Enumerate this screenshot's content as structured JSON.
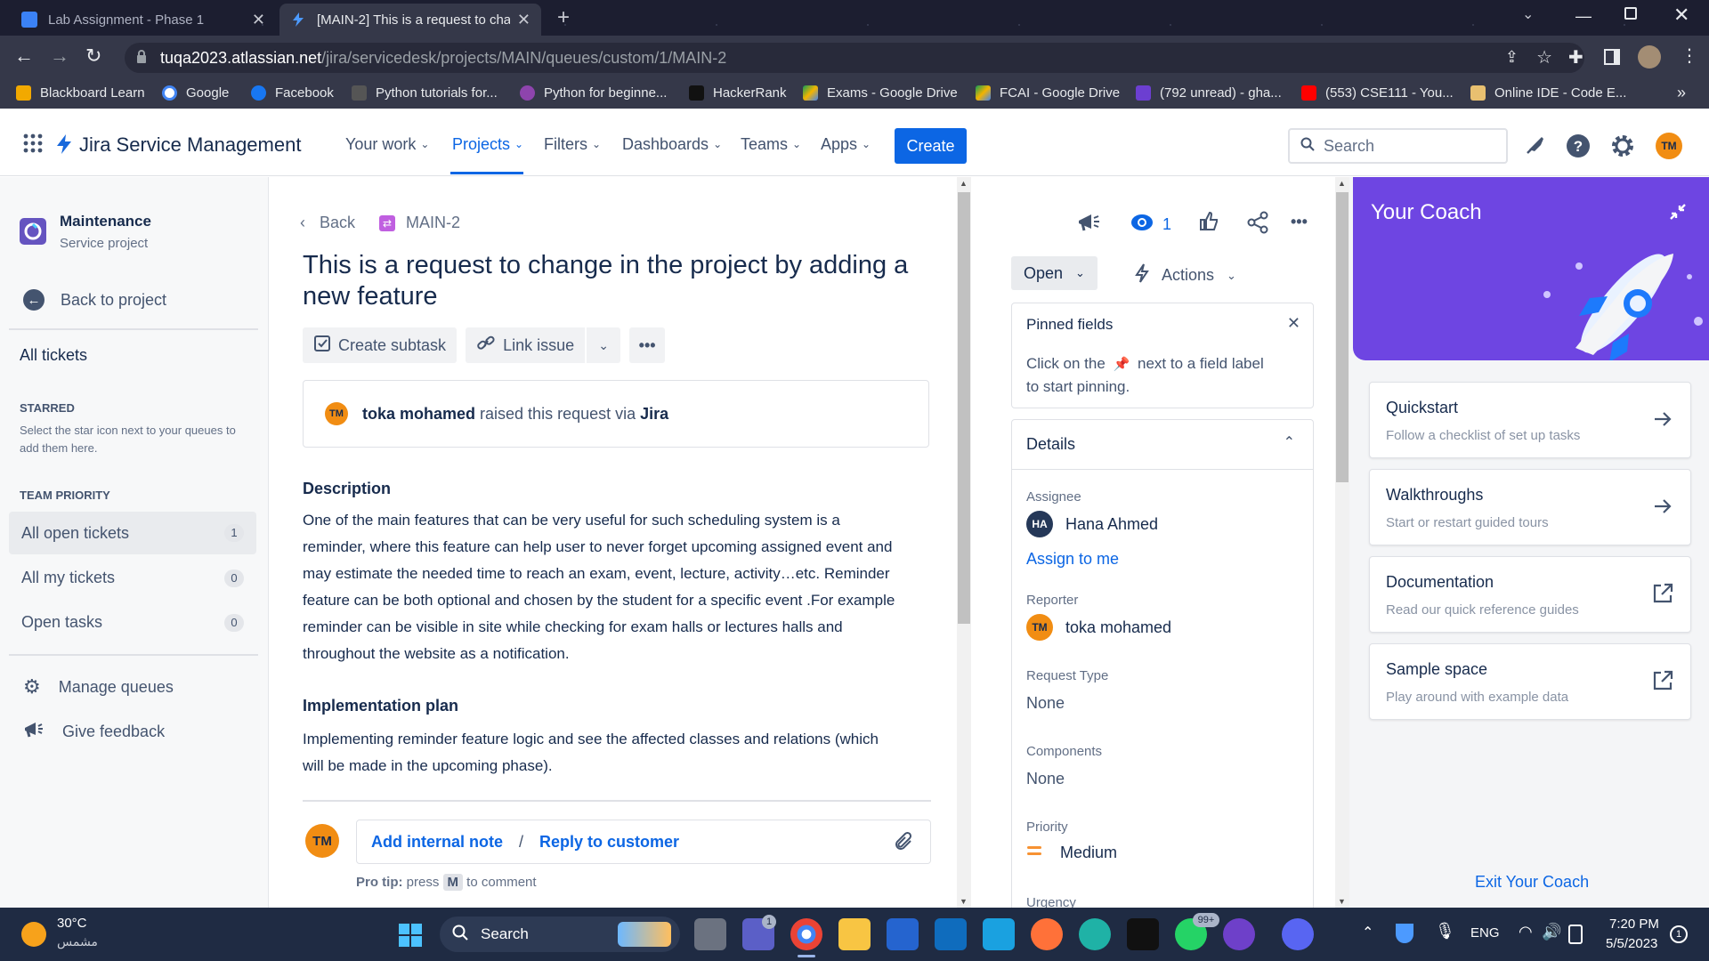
{
  "browser": {
    "tabs": [
      {
        "title": "Lab Assignment - Phase 1",
        "active": false
      },
      {
        "title": "[MAIN-2] This is a request to cha",
        "active": true
      }
    ],
    "url_host": "tuqa2023.atlassian.net",
    "url_path": "/jira/servicedesk/projects/MAIN/queues/custom/1/MAIN-2",
    "bookmarks": [
      "Blackboard Learn",
      "Google",
      "Facebook",
      "Python tutorials for...",
      "Python for beginne...",
      "HackerRank",
      "Exams - Google Drive",
      "FCAI - Google Drive",
      "(792 unread) - gha...",
      "(553) CSE111 - You...",
      "Online IDE - Code E..."
    ]
  },
  "nav": {
    "product": "Jira Service Management",
    "items": [
      "Your work",
      "Projects",
      "Filters",
      "Dashboards",
      "Teams",
      "Apps"
    ],
    "active": "Projects",
    "create": "Create",
    "search_placeholder": "Search",
    "user_initials": "TM"
  },
  "sidebar": {
    "project_name": "Maintenance",
    "project_type": "Service project",
    "back": "Back to project",
    "all_tickets": "All tickets",
    "starred_heading": "STARRED",
    "starred_hint": "Select the star icon next to your queues to add them here.",
    "team_priority_heading": "TEAM PRIORITY",
    "queues": [
      {
        "label": "All open tickets",
        "count": "1"
      },
      {
        "label": "All my tickets",
        "count": "0"
      },
      {
        "label": "Open tasks",
        "count": "0"
      }
    ],
    "manage_queues": "Manage queues",
    "give_feedback": "Give feedback"
  },
  "issue": {
    "back": "Back",
    "key": "MAIN-2",
    "title_line1": "This is a request to change in the project by adding a",
    "title_line2": "new feature",
    "actions": {
      "create_subtask": "Create subtask",
      "link_issue": "Link issue"
    },
    "raised": {
      "user": "toka mohamed",
      "text": " raised this request via ",
      "channel": "Jira",
      "initials": "TM"
    },
    "description_heading": "Description",
    "description_lines": [
      "One of the main features that can be very useful for such scheduling system is a",
      "reminder, where this feature can help user to never forget upcoming assigned event and",
      "may estimate the needed time to reach an exam, event, lecture, activity…etc. Reminder",
      "feature can be both optional and chosen by the student for a specific event .For example",
      "reminder can be visible in site while checking for exam halls or lectures halls and",
      "throughout the website as a notification."
    ],
    "implementation_heading": "Implementation plan",
    "implementation_lines": [
      "Implementing reminder feature logic and see the affected classes and relations (which",
      "will be made in the upcoming phase)."
    ],
    "comment": {
      "initials": "TM",
      "internal_note": "Add internal note",
      "separator": "/",
      "reply": "Reply to customer",
      "tip_bold": "Pro tip:",
      "tip_pre": " press ",
      "tip_key": "M",
      "tip_post": " to comment"
    }
  },
  "details_panel": {
    "watchers": "1",
    "status": "Open",
    "actions": "Actions",
    "pinned_title": "Pinned fields",
    "pinned_hint_a": "Click on the",
    "pinned_hint_b": "next to a field label",
    "pinned_hint_c": "to start pinning.",
    "details_title": "Details",
    "assignee_label": "Assignee",
    "assignee_initials": "HA",
    "assignee": "Hana Ahmed",
    "assign_to_me": "Assign to me",
    "reporter_label": "Reporter",
    "reporter_initials": "TM",
    "reporter": "toka mohamed",
    "request_type_label": "Request Type",
    "request_type": "None",
    "components_label": "Components",
    "components": "None",
    "priority_label": "Priority",
    "priority": "Medium",
    "urgency_label": "Urgency"
  },
  "coach": {
    "title": "Your Coach",
    "cards": [
      {
        "title": "Quickstart",
        "subtitle": "Follow a checklist of set up tasks",
        "icon": "arrow-right-icon"
      },
      {
        "title": "Walkthroughs",
        "subtitle": "Start or restart guided tours",
        "icon": "arrow-right-icon"
      },
      {
        "title": "Documentation",
        "subtitle": "Read our quick reference guides",
        "icon": "external-link-icon"
      },
      {
        "title": "Sample space",
        "subtitle": "Play around with example data",
        "icon": "external-link-icon"
      }
    ],
    "exit": "Exit Your Coach",
    "accent": "#6e45e2"
  },
  "taskbar": {
    "weather_temp": "30°C",
    "weather_text": "مشمس",
    "search": "Search",
    "chat_badge": "1",
    "whatsapp_badge": "99+",
    "language": "ENG",
    "time": "7:20 PM",
    "date": "5/5/2023",
    "notif_count": "1"
  }
}
